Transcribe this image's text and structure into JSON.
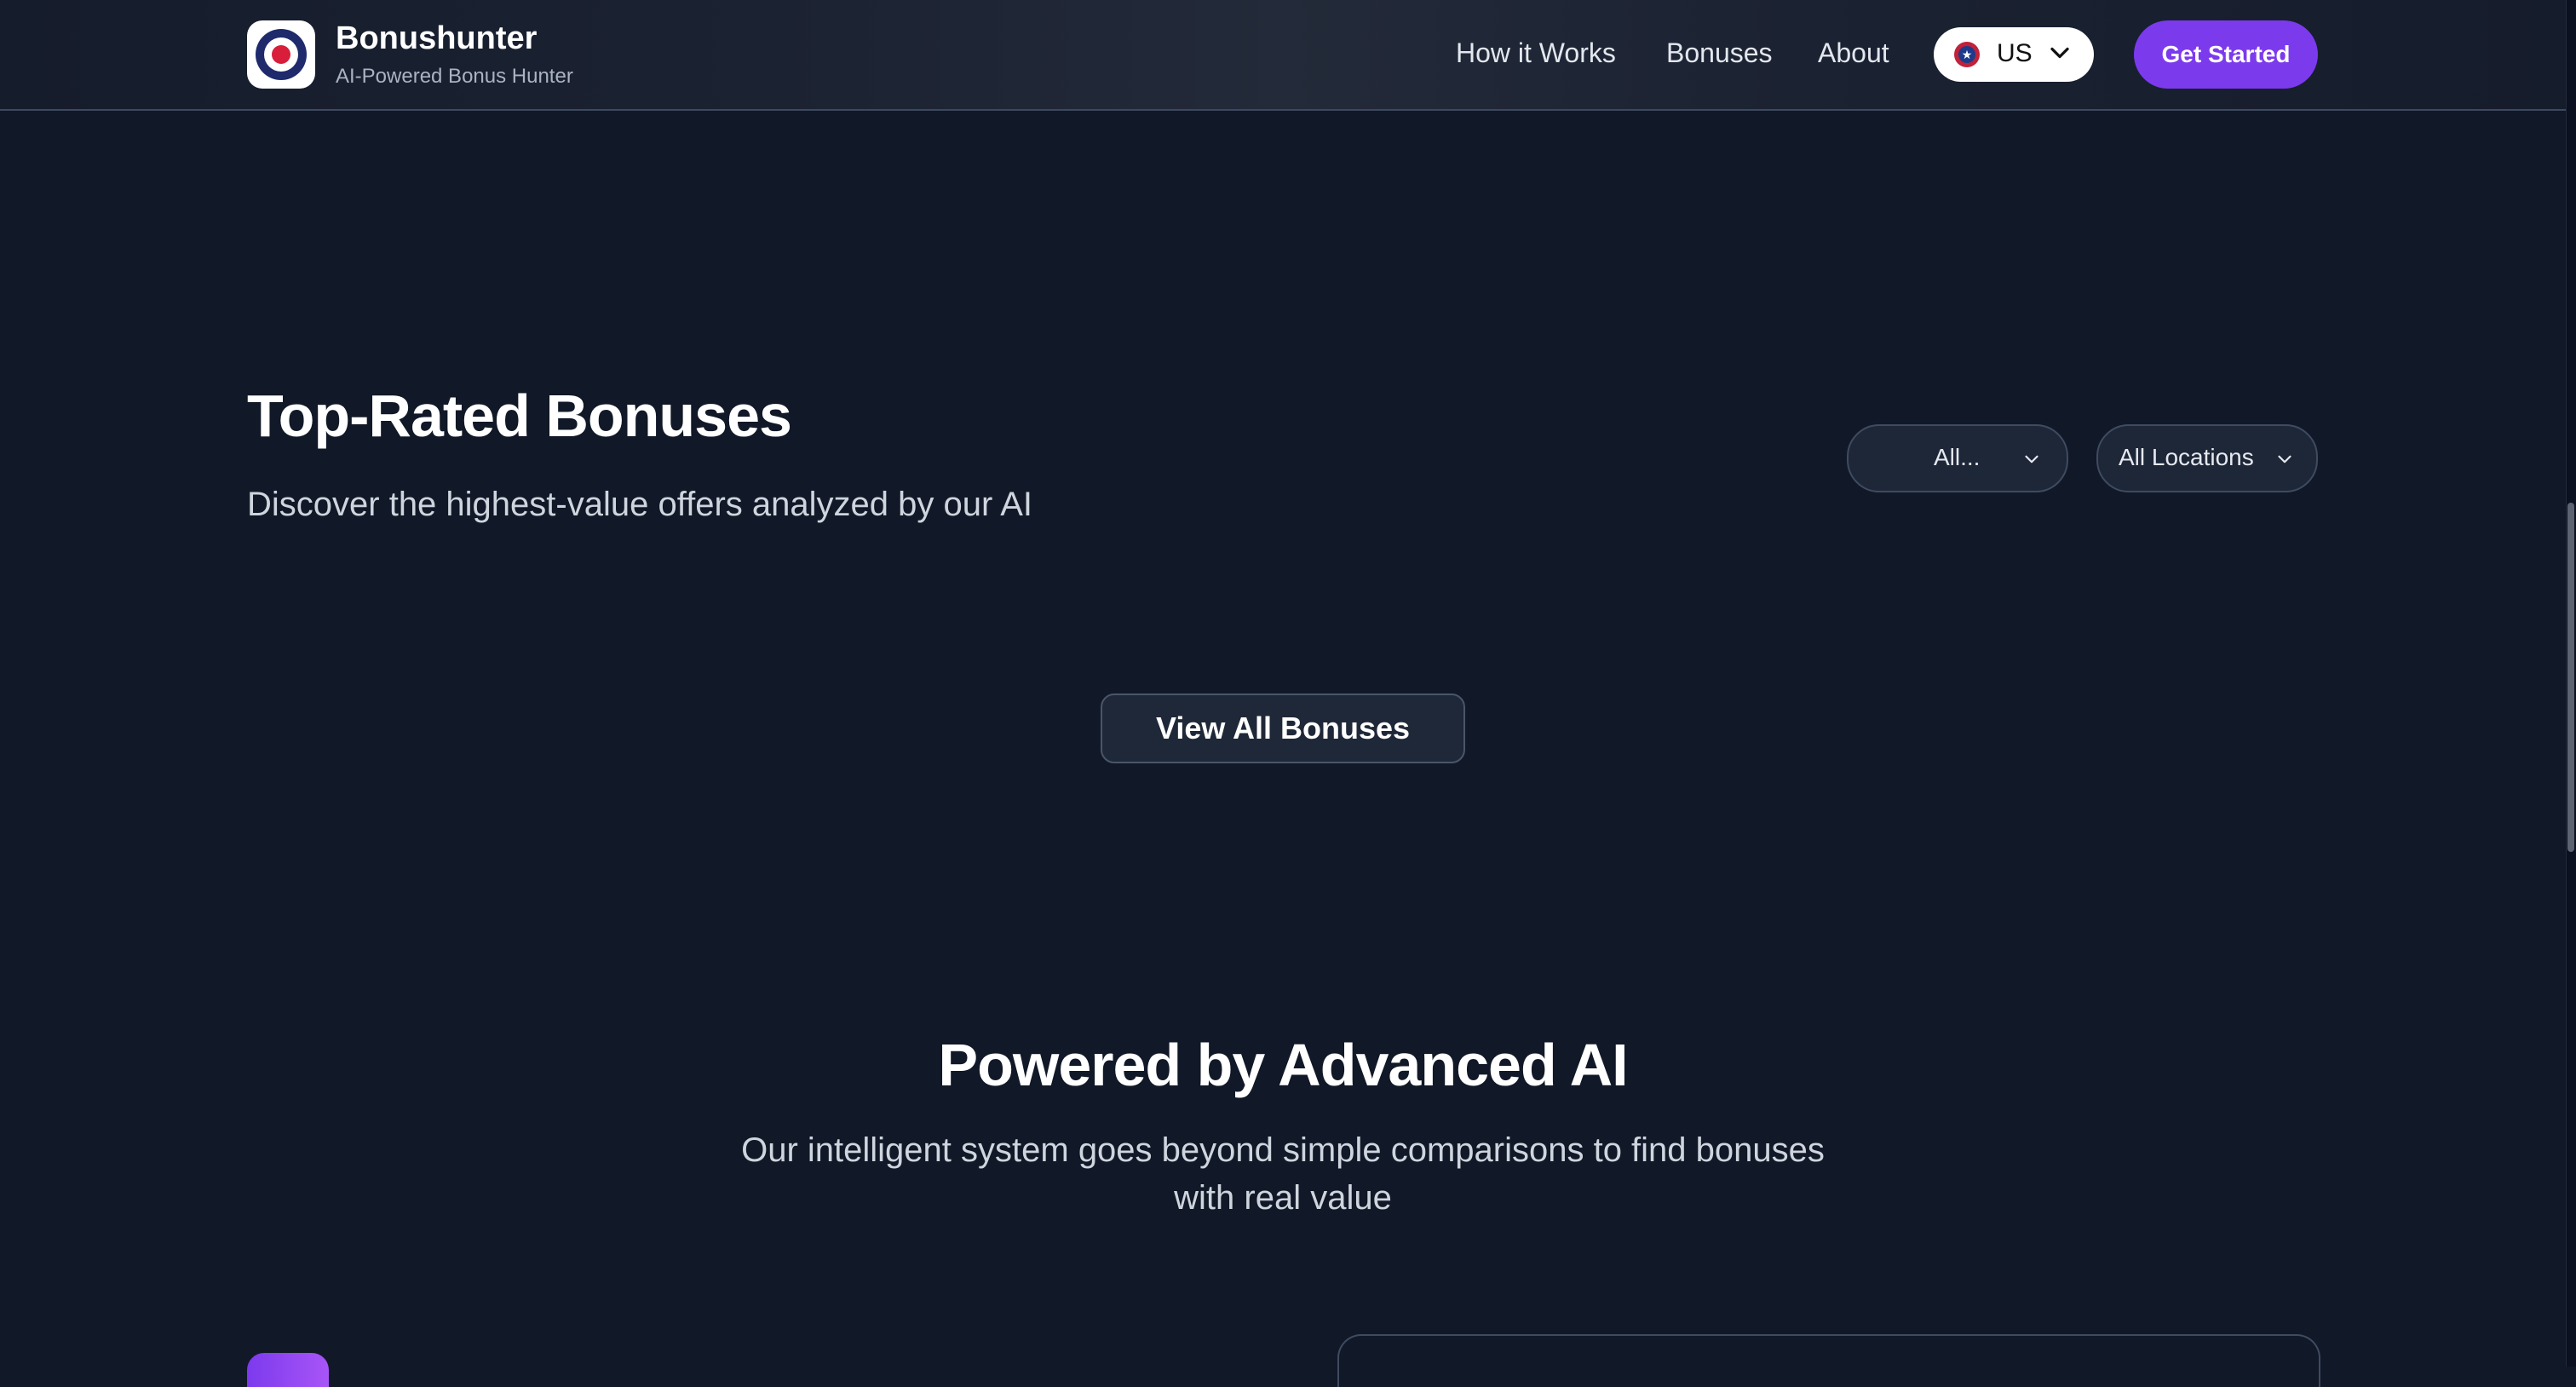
{
  "header": {
    "brand_name": "Bonushunter",
    "brand_tagline": "AI-Powered Bonus Hunter",
    "nav": [
      "How it Works",
      "Bonuses",
      "About"
    ],
    "country_selector": {
      "value": "US",
      "icon": "us-flag-icon"
    },
    "cta_label": "Get Started"
  },
  "top_rated": {
    "title": "Top-Rated Bonuses",
    "subtitle": "Discover the highest-value offers analyzed by our AI",
    "filter_category": "All...",
    "filter_location": "All Locations",
    "view_all_label": "View All Bonuses"
  },
  "ai_section": {
    "title": "Powered by Advanced AI",
    "subtitle_line1": "Our intelligent system goes beyond simple comparisons to find bonuses",
    "subtitle_line2": "with real value"
  },
  "colors": {
    "background": "#111827",
    "accent": "#7c3aed",
    "text_primary": "#ffffff",
    "text_secondary": "#cfd5de"
  }
}
